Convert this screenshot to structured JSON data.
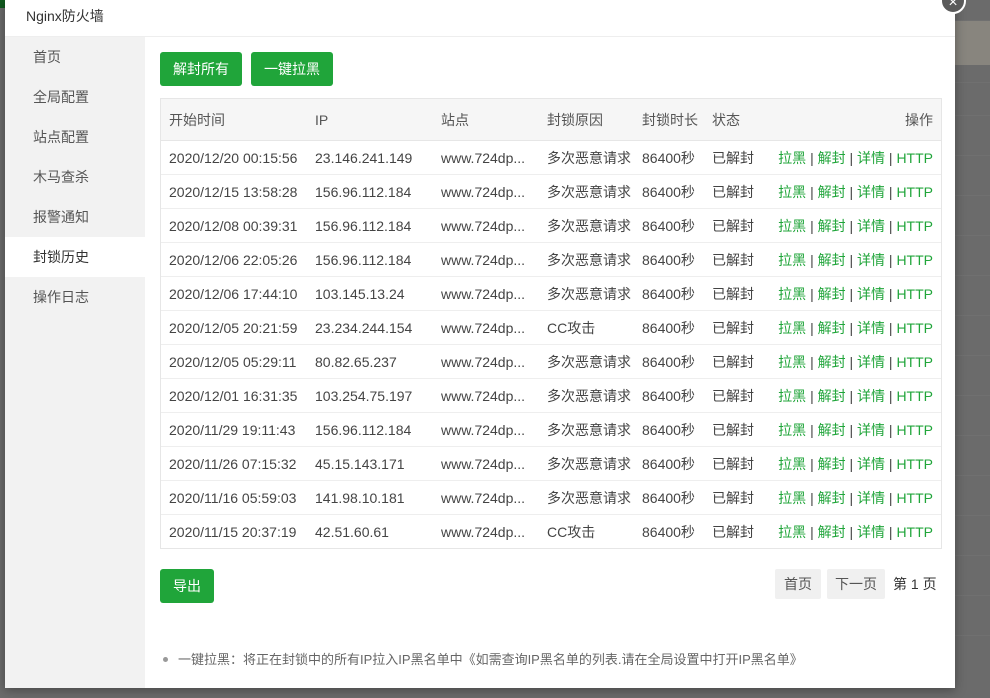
{
  "window": {
    "title": "Nginx防火墙",
    "close_glyph": "×"
  },
  "sidebar": {
    "items": [
      {
        "label": "首页",
        "active": false
      },
      {
        "label": "全局配置",
        "active": false
      },
      {
        "label": "站点配置",
        "active": false
      },
      {
        "label": "木马查杀",
        "active": false
      },
      {
        "label": "报警通知",
        "active": false
      },
      {
        "label": "封锁历史",
        "active": true
      },
      {
        "label": "操作日志",
        "active": false
      }
    ]
  },
  "toolbar": {
    "unblock_all_label": "解封所有",
    "blacklist_all_label": "一键拉黑"
  },
  "table": {
    "headers": {
      "start_time": "开始时间",
      "ip": "IP",
      "site": "站点",
      "reason": "封锁原因",
      "duration": "封锁时长",
      "status": "状态",
      "ops": "操作"
    },
    "actions": {
      "blacklist": "拉黑",
      "unblock": "解封",
      "details": "详情",
      "http": "HTTP",
      "sep": "|"
    },
    "rows": [
      {
        "time": "2020/12/20 00:15:56",
        "ip": "23.146.241.149",
        "site": "www.724dp...",
        "reason": "多次恶意请求",
        "duration": "86400秒",
        "status": "已解封"
      },
      {
        "time": "2020/12/15 13:58:28",
        "ip": "156.96.112.184",
        "site": "www.724dp...",
        "reason": "多次恶意请求",
        "duration": "86400秒",
        "status": "已解封"
      },
      {
        "time": "2020/12/08 00:39:31",
        "ip": "156.96.112.184",
        "site": "www.724dp...",
        "reason": "多次恶意请求",
        "duration": "86400秒",
        "status": "已解封"
      },
      {
        "time": "2020/12/06 22:05:26",
        "ip": "156.96.112.184",
        "site": "www.724dp...",
        "reason": "多次恶意请求",
        "duration": "86400秒",
        "status": "已解封"
      },
      {
        "time": "2020/12/06 17:44:10",
        "ip": "103.145.13.24",
        "site": "www.724dp...",
        "reason": "多次恶意请求",
        "duration": "86400秒",
        "status": "已解封"
      },
      {
        "time": "2020/12/05 20:21:59",
        "ip": "23.234.244.154",
        "site": "www.724dp...",
        "reason": "CC攻击",
        "duration": "86400秒",
        "status": "已解封"
      },
      {
        "time": "2020/12/05 05:29:11",
        "ip": "80.82.65.237",
        "site": "www.724dp...",
        "reason": "多次恶意请求",
        "duration": "86400秒",
        "status": "已解封"
      },
      {
        "time": "2020/12/01 16:31:35",
        "ip": "103.254.75.197",
        "site": "www.724dp...",
        "reason": "多次恶意请求",
        "duration": "86400秒",
        "status": "已解封"
      },
      {
        "time": "2020/11/29 19:11:43",
        "ip": "156.96.112.184",
        "site": "www.724dp...",
        "reason": "多次恶意请求",
        "duration": "86400秒",
        "status": "已解封"
      },
      {
        "time": "2020/11/26 07:15:32",
        "ip": "45.15.143.171",
        "site": "www.724dp...",
        "reason": "多次恶意请求",
        "duration": "86400秒",
        "status": "已解封"
      },
      {
        "time": "2020/11/16 05:59:03",
        "ip": "141.98.10.181",
        "site": "www.724dp...",
        "reason": "多次恶意请求",
        "duration": "86400秒",
        "status": "已解封"
      },
      {
        "time": "2020/11/15 20:37:19",
        "ip": "42.51.60.61",
        "site": "www.724dp...",
        "reason": "CC攻击",
        "duration": "86400秒",
        "status": "已解封"
      }
    ]
  },
  "footer": {
    "export_label": "导出"
  },
  "pagination": {
    "first_label": "首页",
    "next_label": "下一页",
    "current_page": "第 1 页"
  },
  "note": {
    "text": "一键拉黑：将正在封锁中的所有IP拉入IP黑名单中《如需查询IP黑名单的列表.请在全局设置中打开IP黑名单》"
  },
  "colors": {
    "accent": "#20a53a",
    "overlay": "#000000",
    "sidebar_bg": "#f2f2f2"
  }
}
